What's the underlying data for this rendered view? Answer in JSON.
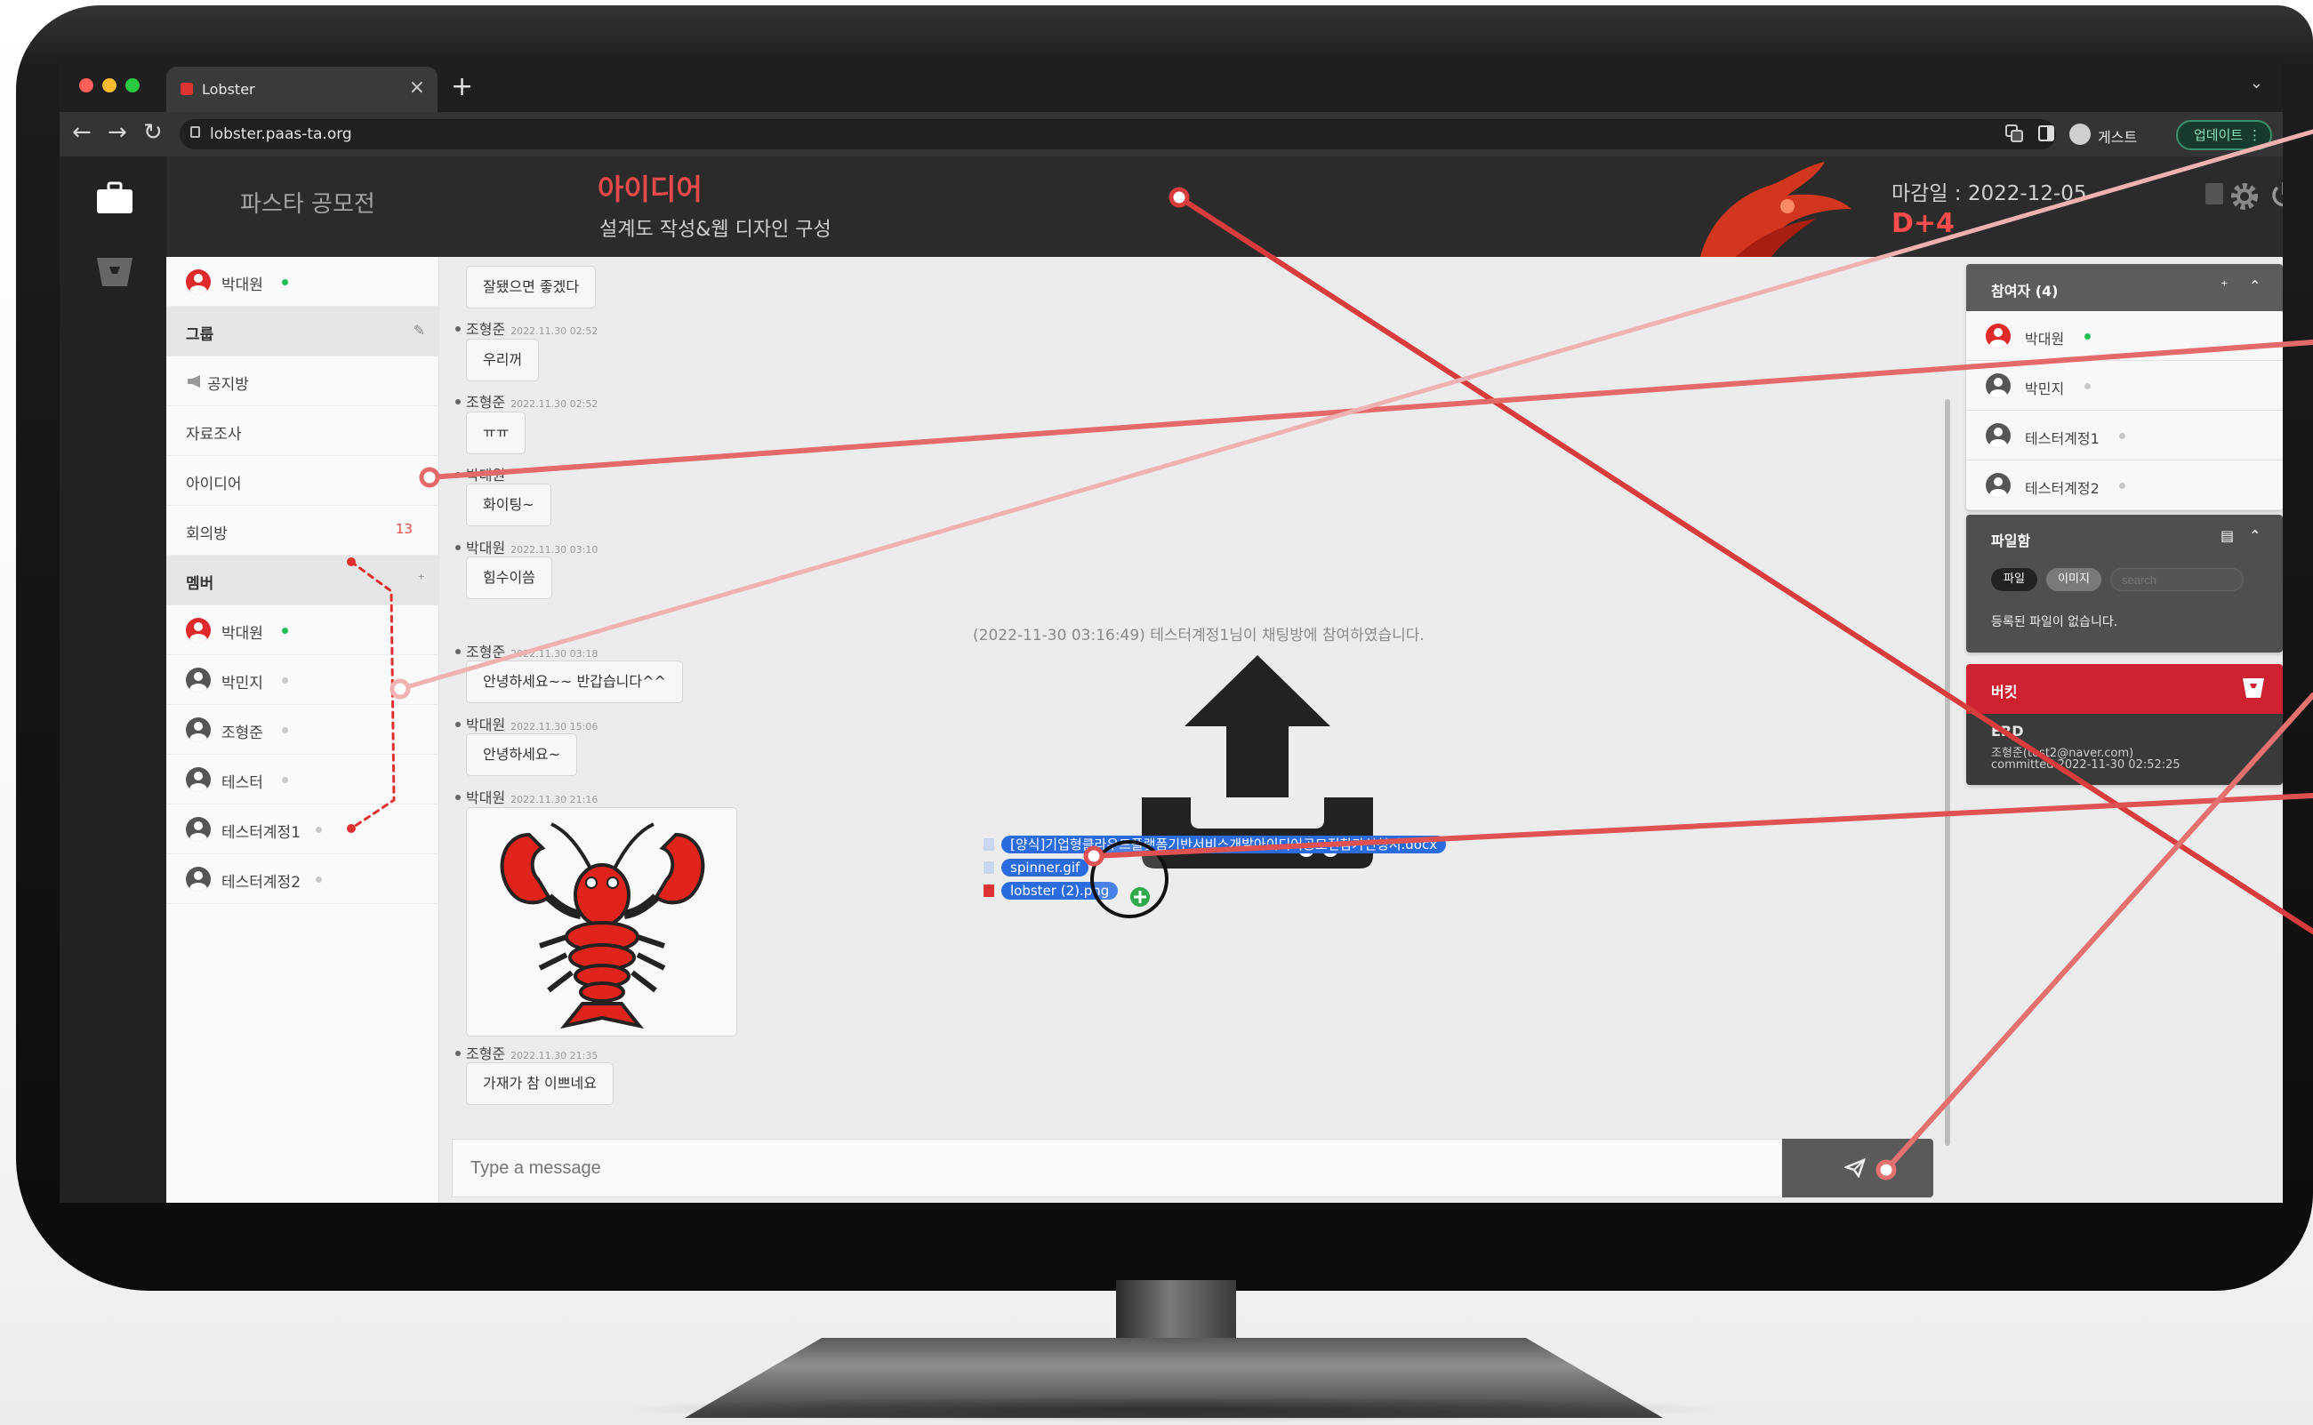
{
  "browser": {
    "tab_title": "Lobster",
    "close_glyph": "×",
    "new_tab_glyph": "+",
    "tab_menu_glyph": "⌄",
    "url": "lobster.paas-ta.org",
    "back_glyph": "←",
    "forward_glyph": "→",
    "reload_glyph": "↻",
    "profile_label": "게스트",
    "update_label": "업데이트",
    "menu_glyph": "⋮"
  },
  "header": {
    "workspace": "파스타 공모전",
    "room_title": "아이디어",
    "room_description": "설계도 작성&웹 디자인 구성",
    "deadline": "마감일 : 2022-12-05",
    "dday": "D+4"
  },
  "sidebar": {
    "me": {
      "name": "박대원",
      "online": true
    },
    "group_section": "그룹",
    "rooms": [
      {
        "label": "공지방",
        "icon": "megaphone-icon"
      },
      {
        "label": "자료조사"
      },
      {
        "label": "아이디어"
      },
      {
        "label": "회의방",
        "badge": "13"
      }
    ],
    "member_section": "멤버",
    "members": [
      {
        "name": "박대원",
        "online": true,
        "accent": true
      },
      {
        "name": "박민지",
        "online": false
      },
      {
        "name": "조형준",
        "online": false
      },
      {
        "name": "테스터",
        "online": false
      },
      {
        "name": "테스터계정1",
        "online": false
      },
      {
        "name": "테스터계정2",
        "online": false
      }
    ]
  },
  "chat": {
    "messages": [
      {
        "author": "",
        "time": "",
        "text": "잘됐으면 좋겠다"
      },
      {
        "author": "조형준",
        "time": "2022.11.30 02:52",
        "text": "우리꺼"
      },
      {
        "author": "조형준",
        "time": "2022.11.30 02:52",
        "text": "ㅠㅠ"
      },
      {
        "author": "박대원",
        "time": "",
        "text": "화이팅~"
      },
      {
        "author": "박대원",
        "time": "2022.11.30 03:10",
        "text": "힘수이씀"
      },
      {
        "author": "조형준",
        "time": "2022.11.30 03:18",
        "text": "안녕하세요~~ 반갑습니다^^"
      },
      {
        "author": "박대원",
        "time": "2022.11.30 15:06",
        "text": "안녕하세요~"
      },
      {
        "author": "박대원",
        "time": "2022.11.30 21:16",
        "image": "lobster-image"
      },
      {
        "author": "조형준",
        "time": "2022.11.30 21:35",
        "text": "가재가 참 이쁘네요"
      }
    ],
    "system_message": "(2022-11-30 03:16:49) 테스터계정1님이 채팅방에 참여하였습니다.",
    "dragged_files": [
      "[양식]기업형클라우드플랫폼기반서비스개발아이디어공모전참가신청서.docx",
      "spinner.gif",
      "lobster (2).png"
    ],
    "composer_placeholder": "Type a message"
  },
  "participants": {
    "title": "참여자 (4)",
    "list": [
      {
        "name": "박대원",
        "online": true,
        "accent": true
      },
      {
        "name": "박민지",
        "online": false
      },
      {
        "name": "테스터계정1",
        "online": false
      },
      {
        "name": "테스터계정2",
        "online": false
      }
    ]
  },
  "filebox": {
    "title": "파일함",
    "tabs": [
      "파일",
      "이미지"
    ],
    "search_placeholder": "search",
    "empty_text": "등록된 파일이 없습니다."
  },
  "bucket": {
    "title": "버킷",
    "item_title": "ERD",
    "item_author": "조형준(test2@naver.com)",
    "item_committed": "committed 2022-11-30 02:52:25"
  },
  "colors": {
    "accent_red": "#e84a4a",
    "online_green": "#21c054",
    "bucket_red": "#cf2231",
    "annotation_line": "#e05252"
  }
}
